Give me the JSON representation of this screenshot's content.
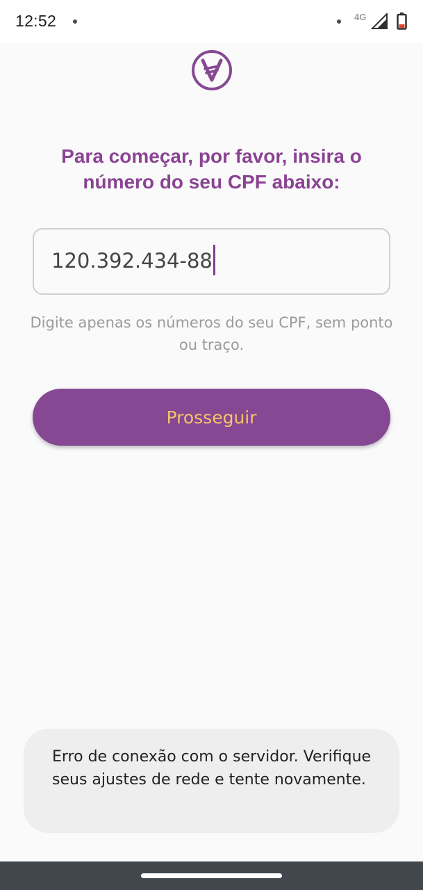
{
  "status_bar": {
    "time": "12:52",
    "network_label": "4G",
    "icons": [
      "notification-dot-icon",
      "signal-icon",
      "battery-icon"
    ]
  },
  "app": {
    "logo_icon": "v-coin-logo-icon",
    "accent_color": "#864893",
    "heading_color": "#8a4393",
    "button_text_color": "#f5c26b"
  },
  "form": {
    "heading": "Para começar, por favor, insira o número do seu CPF abaixo:",
    "cpf_value": "120.392.434-88",
    "helper_text": "Digite apenas os números do seu CPF, sem ponto ou traço.",
    "continue_label": "Prosseguir"
  },
  "toast": {
    "message": "Erro de conexão com o servidor. Verifique seus ajustes de rede e tente novamente."
  }
}
